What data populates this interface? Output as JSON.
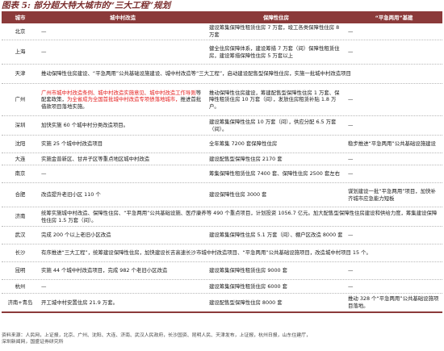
{
  "title": "图表 5:  部分超大特大城市的“三大工程”规划",
  "headers": [
    "城市",
    "城中村改造",
    "保障性住房",
    "“平急两用”基建"
  ],
  "rows": [
    {
      "city": "北京",
      "renew": "—",
      "housing": "建设筹集保障性租赁住房 7 万套，竣工各类保障性住房 8 万套",
      "dual": "—"
    },
    {
      "city": "上海",
      "renew": "—",
      "housing": "健全住房保障体系，建设筹措 7 万套（间）保障性租赁住房，建设筹措保障性住房 5 万套以上",
      "dual": "—"
    },
    {
      "city": "天津",
      "merged": "推动保障性住房建设、“平急两用”公共基础设施建设、城中村改造等“三大工程”，启动建设配售型保障性住房，实施一批城中村改造项目"
    },
    {
      "city": "广州",
      "renew": "",
      "renew_red": "广州市城中村改造条例、城中村改造实施意见、城中村改造工作导则",
      "renew_mid": "等配套政策，",
      "renew_red2": "为全省成为全国首批城中村改造专项债落地城市，",
      "renew_tail": "推进首批借款项目落地实施。",
      "housing": "推动保障性住房建设，筹建配售型保障性住房 1 万套、保障性租赁住房 10 万套（间），发放住房租赁补贴 1.8 万户。",
      "dual": "—"
    },
    {
      "city": "深圳",
      "renew": "加快实施 60 个城中村分类改造项目。",
      "housing": "建设筹集保障性住房 10 万套（间），供应分配 6.5 万套（间）。",
      "dual": "—"
    },
    {
      "city": "沈阳",
      "renew": "实施 25 个城中村改造项目",
      "housing": "全年筹集 7200 套保障性住房",
      "dual": "稳步推进“平急两用”公共基础设施建设"
    },
    {
      "city": "大连",
      "renew": "实施金普新区、甘井子区等重点地区城中村改造",
      "housing": "建设配售型保障性住房 2170 套",
      "dual": "—"
    },
    {
      "city": "南京",
      "renew": "—",
      "housing": "筹集保障性租赁住房 7400 套、保障性住房 2500 套左右",
      "dual": "—"
    },
    {
      "city": "合肥",
      "renew": "改造提升老旧小区 110 个",
      "housing": "建设保障性住房 3000 套",
      "dual": "谋划建设一批“平急两用”项目，加快补齐城市应急能力短板"
    },
    {
      "city": "济南",
      "merged": "统筹实施城中村改造、保障性住房、“平急两用”公共基础设施、医疗康养等 490 个重点项目，计划投资 1056.7 亿元。加大配售型保障性住房建设和供给力度，筹集建设保障性住房 1.5 万套（间）。"
    },
    {
      "city": "武汉",
      "renew": "完成 200 个以上老旧小区改造",
      "housing": "建设筹集保障性住房 5.1 万套（间）、棚户区改造 8000 套",
      "dual": "—"
    },
    {
      "city": "长沙",
      "merged": "有序推进“三大工程”，统筹建设保障性住房，加快建设长吉高速长沙市城中村改造项目、“平急两用”公共基础设施项目，改造城中村项目 15 个。"
    },
    {
      "city": "昆明",
      "renew": "实施 44 个城中村改造项目，完成 982 个老旧小区改造",
      "housing": "建设筹集保障性租赁住房 9000 套",
      "dual": "—"
    },
    {
      "city": "杭州",
      "renew": "—",
      "housing": "建设筹集保障性租赁住房 6000 套",
      "dual": "—"
    },
    {
      "city": "济南+青岛",
      "renew": "开工城中村安置住房 21.9 万套。",
      "housing": "建设配售型保障性住房 8000 套",
      "dual": "推动 328 个“平急两用”公共基础设施项目落地。"
    }
  ],
  "source_line1": "资料来源：人民网，上证报，北京、广州、沈阳、大连、济南、武汉人民政府，长沙国资、昆明人民、天津发布，上证报，杭州日报，山东住建厅，",
  "source_line2": "深圳新闻网，国盛证券研究所"
}
